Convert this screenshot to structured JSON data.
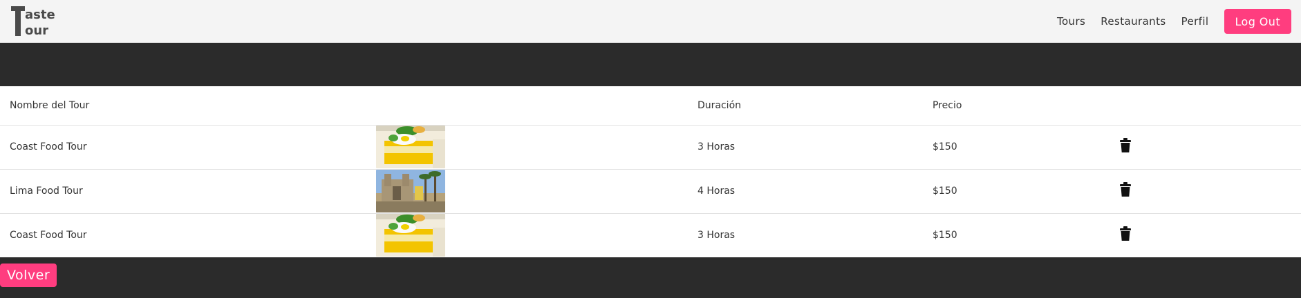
{
  "brand": {
    "logo_alt": "Taste Tour"
  },
  "nav": {
    "links": [
      "Tours",
      "Restaurants",
      "Perfil"
    ],
    "logout_label": "Log Out"
  },
  "table": {
    "headers": [
      "Nombre del Tour",
      "",
      "Duración",
      "Precio",
      ""
    ],
    "rows": [
      {
        "name": "Coast Food Tour",
        "image": "causa-dish",
        "duration": "3 Horas",
        "price": "$150"
      },
      {
        "name": "Lima Food Tour",
        "image": "lima-cathedral",
        "duration": "4 Horas",
        "price": "$150"
      },
      {
        "name": "Coast Food Tour",
        "image": "causa-dish",
        "duration": "3 Horas",
        "price": "$150"
      }
    ]
  },
  "back_label": "Volver",
  "colors": {
    "accent": "#ff3d7f",
    "dark": "#2b2b2b",
    "navbar": "#f4f4f4"
  }
}
